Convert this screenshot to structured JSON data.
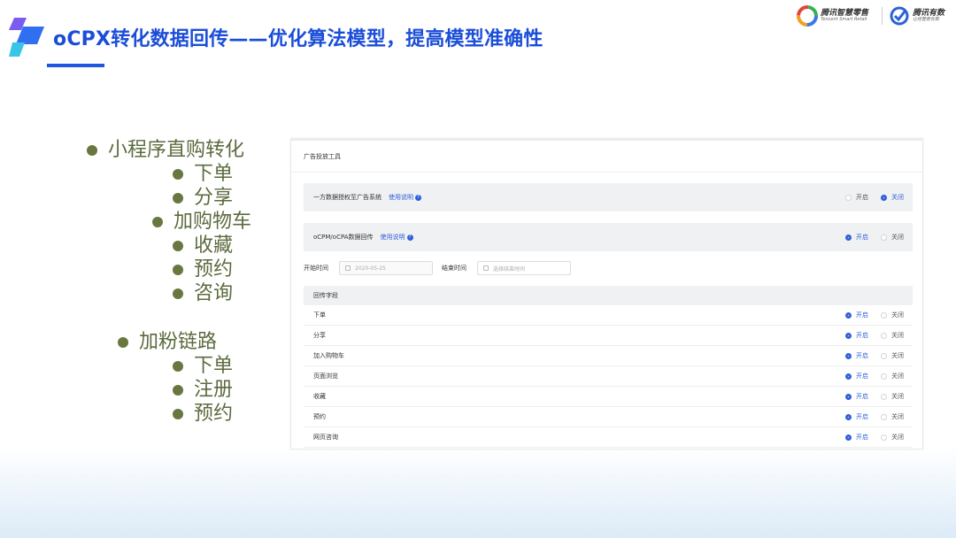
{
  "header": {
    "title": "oCPX转化数据回传——优化算法模型，提高模型准确性",
    "brand_1_cn": "腾讯智慧零售",
    "brand_1_en": "Tencent Smart Retail",
    "brand_2_cn": "腾讯有数",
    "brand_2_en": "让经营更有数"
  },
  "bullets": [
    {
      "label": "小程序直购转化"
    },
    {
      "label": "下单"
    },
    {
      "label": "分享"
    },
    {
      "label": "加购物车"
    },
    {
      "label": "收藏"
    },
    {
      "label": "预约"
    },
    {
      "label": "咨询"
    },
    {
      "label": "加粉链路"
    },
    {
      "label": "下单"
    },
    {
      "label": "注册"
    },
    {
      "label": "预约"
    }
  ],
  "panel": {
    "title": "广告投放工具",
    "setting_1": {
      "label": "一方数据授权至广告系统",
      "help": "使用说明",
      "on_label": "开启",
      "off_label": "关闭",
      "selected": "off"
    },
    "setting_2": {
      "label": "oCPM/oCPA数据回传",
      "help": "使用说明",
      "on_label": "开启",
      "off_label": "关闭",
      "selected": "on"
    },
    "start_label": "开始时间",
    "start_value": "2020-05-25",
    "end_label": "结束时间",
    "end_placeholder": "选择结束时间",
    "fields_header": "回传字段",
    "on_label": "开启",
    "off_label": "关闭",
    "fields": [
      {
        "label": "下单",
        "selected": "on"
      },
      {
        "label": "分享",
        "selected": "on"
      },
      {
        "label": "加入购物车",
        "selected": "on"
      },
      {
        "label": "页面浏览",
        "selected": "on"
      },
      {
        "label": "收藏",
        "selected": "on"
      },
      {
        "label": "预约",
        "selected": "on"
      },
      {
        "label": "网页咨询",
        "selected": "on"
      }
    ]
  },
  "colors": {
    "title": "#1b4ed8",
    "accent": "#2f5fd8",
    "bullet_text": "#5b6b3e"
  }
}
